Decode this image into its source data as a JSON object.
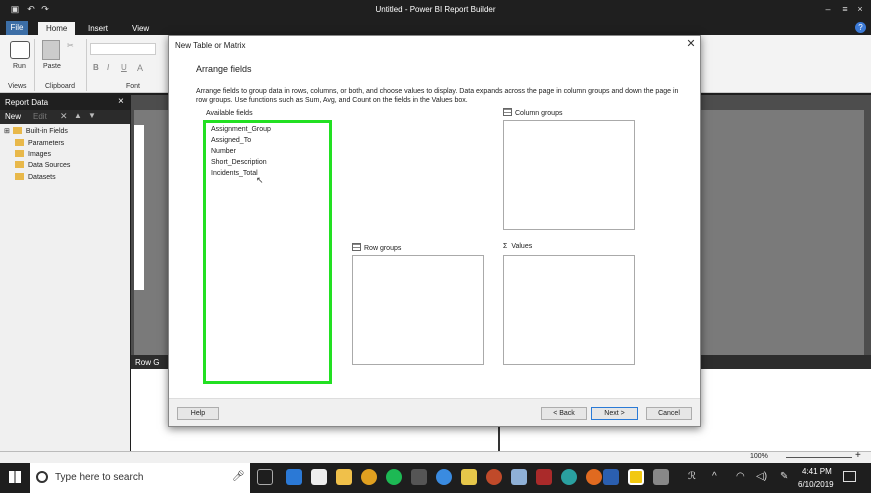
{
  "window": {
    "title": "Untitled - Power BI Report Builder",
    "minimize_glyph": "–",
    "restore_glyph": "≡",
    "close_glyph": "×"
  },
  "ribbon": {
    "tabs": {
      "file": "File",
      "home": "Home",
      "insert": "Insert",
      "view": "View"
    },
    "run_label": "Run",
    "paste_label": "Paste",
    "groups": {
      "views": "Views",
      "clipboard": "Clipboard",
      "font": "Font"
    },
    "font_buttons": {
      "bold": "B",
      "italic": "I",
      "underline": "U",
      "color": "A"
    }
  },
  "report_data": {
    "title": "Report Data",
    "new_label": "New",
    "edit_label": "Edit",
    "items": {
      "builtin": "Built-in Fields",
      "parameters": "Parameters",
      "images": "Images",
      "datasources": "Data Sources",
      "datasets": "Datasets"
    }
  },
  "design": {
    "row_groups_label": "Row G"
  },
  "dialog": {
    "title": "New Table or Matrix",
    "close_glyph": "✕",
    "heading": "Arrange fields",
    "description": "Arrange fields to group data in rows, columns, or both, and choose values to display. Data expands across the page in column groups and down the page in row groups.  Use functions such as Sum, Avg, and Count on the fields in the Values box.",
    "available_fields_label": "Available fields",
    "fields": {
      "f0": "Assignment_Group",
      "f1": "Assigned_To",
      "f2": "Number",
      "f3": "Short_Description",
      "f4": "Incidents_Total"
    },
    "column_groups_label": "Column groups",
    "row_groups_label": "Row groups",
    "values_label": "Values",
    "values_symbol": "Σ",
    "buttons": {
      "help": "Help",
      "back": "< Back",
      "next": "Next >",
      "cancel": "Cancel"
    }
  },
  "statusbar": {
    "zoom": "100%"
  },
  "taskbar": {
    "search_placeholder": "Type here to search",
    "time": "4:41 PM",
    "date": "6/10/2019"
  },
  "colors": {
    "highlight": "#22e022",
    "file_tab": "#3c6ea6"
  }
}
